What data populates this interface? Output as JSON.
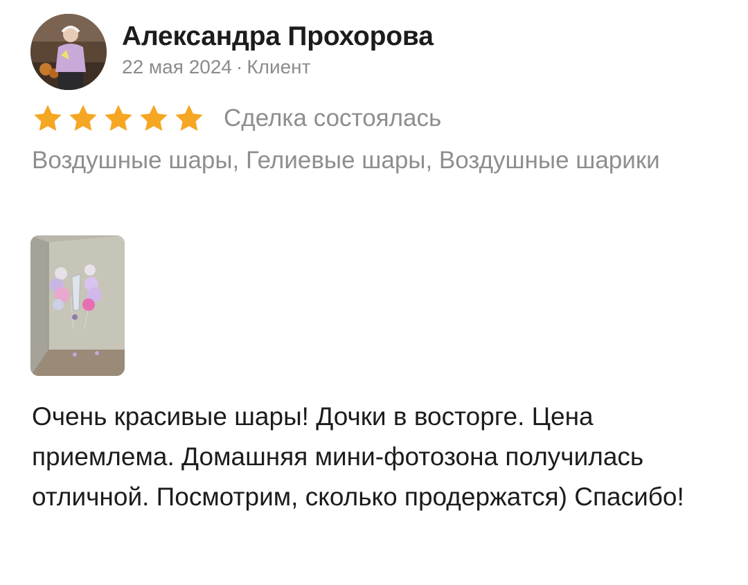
{
  "review": {
    "author": {
      "name": "Александра Прохорова",
      "date": "22 мая 2024",
      "separator": "·",
      "role": "Клиент",
      "avatar_icon": "user-photo-avatar"
    },
    "rating": {
      "stars": 5,
      "max": 5,
      "star_color": "#f5a623",
      "status": "Сделка состоялась"
    },
    "services": "Воздушные шары, Гелиевые шары, Воздушные шарики",
    "photo": {
      "icon": "balloons-photo-thumbnail"
    },
    "text": "Очень красивые шары! Дочки в восторге. Цена приемлема. Домашняя мини-фотозона получилась отличной. Посмотрим, сколько продержатся) Спасибо!"
  }
}
